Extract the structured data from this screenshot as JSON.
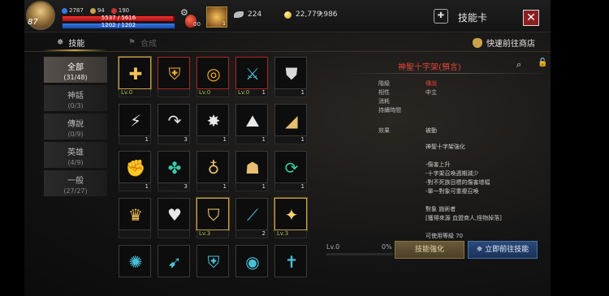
{
  "player": {
    "level": "87",
    "stat_a": "2787",
    "stat_b": "94",
    "stat_c": "190",
    "hp_text": "5537 / 5616",
    "mp_text": "1202 / 1202",
    "hp_ratio": 0.986,
    "mp_ratio": 1.0,
    "potion_count": "00"
  },
  "header": {
    "wings": "224",
    "gold": "22,779,986",
    "title": "技能卡",
    "close_label": "✕"
  },
  "tabs": [
    {
      "label": "技能",
      "active": true
    },
    {
      "label": "合成",
      "active": false
    }
  ],
  "shop_link": "快速前往商店",
  "categories": [
    {
      "name": "全部",
      "count": "(31/48)",
      "active": true
    },
    {
      "name": "神話",
      "count": "(0/3)",
      "active": false
    },
    {
      "name": "傳說",
      "count": "(0/9)",
      "active": false
    },
    {
      "name": "英雄",
      "count": "(4/9)",
      "active": false
    },
    {
      "name": "一般",
      "count": "(27/27)",
      "active": false
    }
  ],
  "cards": [
    {
      "icon": "holy-cross-icon",
      "glyph": "✚",
      "color": "#f3c05a",
      "border": "gold",
      "lv": "Lv.0",
      "num": ""
    },
    {
      "icon": "holy-shield-icon",
      "glyph": "⛨",
      "color": "#f0b030",
      "border": "red",
      "lv": "",
      "num": ""
    },
    {
      "icon": "golden-orb-icon",
      "glyph": "◎",
      "color": "#f6b21a",
      "border": "red",
      "lv": "Lv.0",
      "num": ""
    },
    {
      "icon": "sword-strike-icon",
      "glyph": "⚔",
      "color": "#4ac0d8",
      "border": "red",
      "lv": "Lv.0",
      "num": "1"
    },
    {
      "icon": "shield-icon",
      "glyph": "⛊",
      "color": "#d8d8d8",
      "border": "",
      "lv": "",
      "num": "1"
    },
    {
      "icon": "lightning-icon",
      "glyph": "⚡",
      "color": "#e8e8e8",
      "border": "",
      "lv": "",
      "num": "1"
    },
    {
      "icon": "arc-arrow-icon",
      "glyph": "↷",
      "color": "#e8e8e8",
      "border": "",
      "lv": "",
      "num": "3"
    },
    {
      "icon": "burst-icon",
      "glyph": "✸",
      "color": "#e8e8e8",
      "border": "",
      "lv": "",
      "num": "1"
    },
    {
      "icon": "summon-icon",
      "glyph": "⛰",
      "color": "#e8e8e8",
      "border": "",
      "lv": "",
      "num": "1"
    },
    {
      "icon": "eye-slash-icon",
      "glyph": "◢",
      "color": "#e8c070",
      "border": "",
      "lv": "",
      "num": "1"
    },
    {
      "icon": "fist-icon",
      "glyph": "✊",
      "color": "#e6c070",
      "border": "",
      "lv": "",
      "num": "1"
    },
    {
      "icon": "heal-hand-icon",
      "glyph": "✤",
      "color": "#3ac8a8",
      "border": "",
      "lv": "",
      "num": "3"
    },
    {
      "icon": "orb-bearer-icon",
      "glyph": "♁",
      "color": "#e6c070",
      "border": "",
      "lv": "",
      "num": "1"
    },
    {
      "icon": "helmet-icon",
      "glyph": "☗",
      "color": "#e6c070",
      "border": "",
      "lv": "",
      "num": "1"
    },
    {
      "icon": "cycle-icon",
      "glyph": "⟳",
      "color": "#3ac8a8",
      "border": "",
      "lv": "",
      "num": "1"
    },
    {
      "icon": "crown-icon",
      "glyph": "♛",
      "color": "#f3c05a",
      "border": "",
      "lv": "",
      "num": ""
    },
    {
      "icon": "heart-icon",
      "glyph": "♥",
      "color": "#e8e8e8",
      "border": "",
      "lv": "",
      "num": ""
    },
    {
      "icon": "winged-shield-icon",
      "glyph": "⛉",
      "color": "#f6d070",
      "border": "gold",
      "lv": "Lv.3",
      "num": ""
    },
    {
      "icon": "blade-icon",
      "glyph": "⟋",
      "color": "#4ac0d8",
      "border": "",
      "lv": "",
      "num": "2"
    },
    {
      "icon": "radiant-sword-icon",
      "glyph": "✦",
      "color": "#f6d070",
      "border": "gold",
      "lv": "Lv.3",
      "num": ""
    },
    {
      "icon": "aura-icon",
      "glyph": "✺",
      "color": "#4ac0d8",
      "border": "",
      "lv": "",
      "num": ""
    },
    {
      "icon": "dash-icon",
      "glyph": "➹",
      "color": "#4ac0d8",
      "border": "",
      "lv": "",
      "num": ""
    },
    {
      "icon": "guard-icon",
      "glyph": "⛨",
      "color": "#4ac0d8",
      "border": "",
      "lv": "",
      "num": ""
    },
    {
      "icon": "shield-ring-icon",
      "glyph": "◉",
      "color": "#4ac0d8",
      "border": "",
      "lv": "",
      "num": ""
    },
    {
      "icon": "cross-blade-icon",
      "glyph": "✝",
      "color": "#4ac0d8",
      "border": "",
      "lv": "",
      "num": ""
    }
  ],
  "detail": {
    "name": "神聖十字架(預言)",
    "rows": [
      {
        "key": "階級",
        "value": "傳說",
        "red": true
      },
      {
        "key": "相性",
        "value": "中立",
        "red": false
      },
      {
        "key": "消耗",
        "value": "",
        "red": false
      },
      {
        "key": "持續時間",
        "value": "",
        "red": false
      }
    ],
    "effect_key": "效果",
    "effect_val": "被動",
    "desc": [
      "神聖十字架強化",
      "",
      "-傷害上升",
      "-十字架召喚週期減少",
      "-對不死族目標的傷害增幅",
      "-單一對象可重複召喚",
      "",
      "對象 施術者",
      "[獲得來源 血盟商人,怪物掉落]",
      "",
      "可使用等級 70"
    ]
  },
  "progress": {
    "level": "Lv.0",
    "percent_text": "0%",
    "ratio": 0
  },
  "buttons": {
    "enhance": "技能強化",
    "goto_skill": "立即前往技能"
  }
}
